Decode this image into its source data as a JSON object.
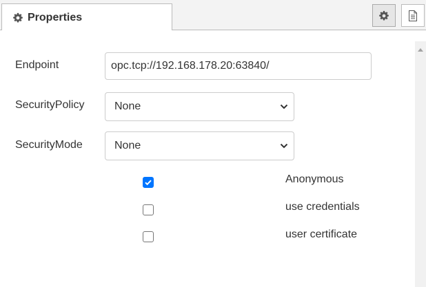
{
  "tabs": {
    "properties_label": "Properties",
    "settings_icon": "gear-icon",
    "info_icon": "document-icon"
  },
  "form": {
    "endpoint": {
      "label": "Endpoint",
      "value": "opc.tcp://192.168.178.20:63840/"
    },
    "security_policy": {
      "label": "SecurityPolicy",
      "value": "None"
    },
    "security_mode": {
      "label": "SecurityMode",
      "value": "None"
    },
    "auth_options": [
      {
        "label": "Anonymous",
        "checked": true
      },
      {
        "label": "use credentials",
        "checked": false
      },
      {
        "label": "user certificate",
        "checked": false
      }
    ]
  },
  "colors": {
    "accent": "#0075ff",
    "border": "#cccccc",
    "text": "#333333"
  }
}
